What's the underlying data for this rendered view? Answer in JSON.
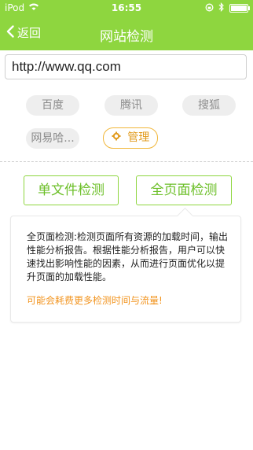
{
  "status_bar": {
    "carrier": "iPod",
    "time": "16:55",
    "wifi_icon": "wifi-icon",
    "lock_rotation_icon": "rotation-lock-icon",
    "bluetooth_icon": "bluetooth-icon",
    "battery_icon": "battery-icon"
  },
  "nav": {
    "back_label": "返回",
    "title": "网站检测"
  },
  "url_input": {
    "value": "http://www.qq.com"
  },
  "presets": [
    {
      "label": "百度"
    },
    {
      "label": "腾讯"
    },
    {
      "label": "搜狐"
    },
    {
      "label": "网易哈..."
    }
  ],
  "manage": {
    "label": "管理",
    "icon": "gear-icon"
  },
  "actions": {
    "single_file": "单文件检测",
    "full_page": "全页面检测"
  },
  "info_panel": {
    "description": "全页面检测:检测页面所有资源的加载时间，输出性能分析报告。根据性能分析报告，用户可以快速找出影响性能的因素，从而进行页面优化以提升页面的加载性能。",
    "warning": "可能会耗费更多检测时间与流量!"
  },
  "colors": {
    "brand_green": "#8ed63f",
    "accent_orange": "#f2941f"
  }
}
